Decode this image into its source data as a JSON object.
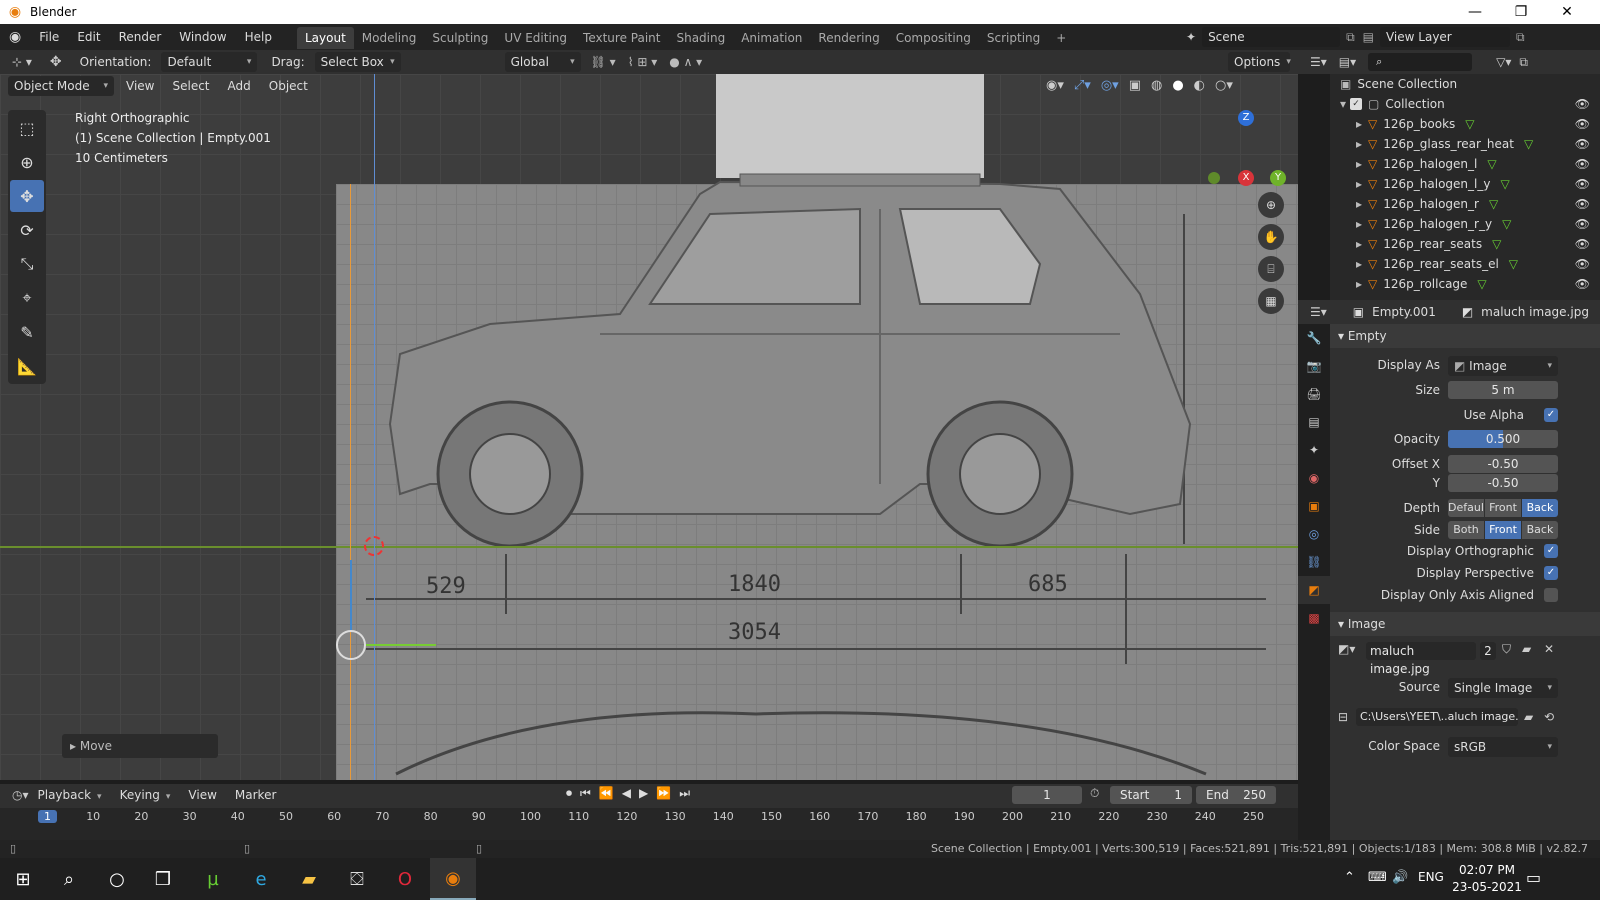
{
  "window": {
    "title": "Blender",
    "minimize": "—",
    "maximize": "❐",
    "close": "✕"
  },
  "menus": [
    "File",
    "Edit",
    "Render",
    "Window",
    "Help"
  ],
  "workspaces": [
    "Layout",
    "Modeling",
    "Sculpting",
    "UV Editing",
    "Texture Paint",
    "Shading",
    "Animation",
    "Rendering",
    "Compositing",
    "Scripting"
  ],
  "workspace_add": "+",
  "scene": {
    "name": "Scene",
    "view_layer": "View Layer"
  },
  "tool_header": {
    "orientation_label": "Orientation:",
    "orientation_value": "Default",
    "drag_label": "Drag:",
    "drag_value": "Select Box",
    "transform_orientation": "Global",
    "options": "Options"
  },
  "viewport_header": {
    "mode": "Object Mode",
    "menus": [
      "View",
      "Select",
      "Add",
      "Object"
    ]
  },
  "viewport_info": {
    "line1": "Right Orthographic",
    "line2": "(1) Scene Collection | Empty.001",
    "line3": "10 Centimeters"
  },
  "gizmo": {
    "z": "Z",
    "x": "X",
    "y": "Y"
  },
  "move_panel": "Move",
  "blueprint": {
    "dims": [
      "529",
      "1840",
      "685",
      "3054"
    ]
  },
  "outliner": {
    "root": "Scene Collection",
    "collection": "Collection",
    "items": [
      "126p_books",
      "126p_glass_rear_heat",
      "126p_halogen_l",
      "126p_halogen_l_y",
      "126p_halogen_r",
      "126p_halogen_r_y",
      "126p_rear_seats",
      "126p_rear_seats_el",
      "126p_rollcage"
    ]
  },
  "properties": {
    "object": "Empty.001",
    "image_name": "maluch image.jpg",
    "empty_section": "Empty",
    "display_as_label": "Display As",
    "display_as": "Image",
    "size_label": "Size",
    "size": "5 m",
    "use_alpha_label": "Use Alpha",
    "opacity_label": "Opacity",
    "opacity": "0.500",
    "opacity_fraction": 0.5,
    "offset_x_label": "Offset X",
    "offset_x": "-0.50",
    "offset_y_label": "Y",
    "offset_y": "-0.50",
    "depth_label": "Depth",
    "depth_options": [
      "Defaul",
      "Front",
      "Back"
    ],
    "side_label": "Side",
    "side_options": [
      "Both",
      "Front",
      "Back"
    ],
    "display_ortho": "Display Orthographic",
    "display_persp": "Display Perspective",
    "display_axis": "Display Only Axis Aligned",
    "image_section": "Image",
    "image_users": "2",
    "source_label": "Source",
    "source": "Single Image",
    "filepath": "C:\\Users\\YEET\\..aluch image.jpg",
    "color_space_label": "Color Space",
    "color_space": "sRGB"
  },
  "timeline": {
    "menus": [
      "Playback",
      "Keying",
      "View",
      "Marker"
    ],
    "current_frame": "1",
    "start_label": "Start",
    "start": "1",
    "end_label": "End",
    "end": "250",
    "ruler": [
      "1",
      "10",
      "20",
      "30",
      "40",
      "50",
      "60",
      "70",
      "80",
      "90",
      "100",
      "110",
      "120",
      "130",
      "140",
      "150",
      "160",
      "170",
      "180",
      "190",
      "200",
      "210",
      "220",
      "230",
      "240",
      "250"
    ]
  },
  "status": "Scene Collection | Empty.001 | Verts:300,519 | Faces:521,891 | Tris:521,891 | Objects:1/183 | Mem: 308.8 MiB | v2.82.7",
  "taskbar": {
    "lang": "ENG",
    "time": "02:07 PM",
    "date": "23-05-2021"
  },
  "colors": {
    "accent": "#4772b3",
    "active_orange": "#e87d0d",
    "bg": "#303030"
  }
}
